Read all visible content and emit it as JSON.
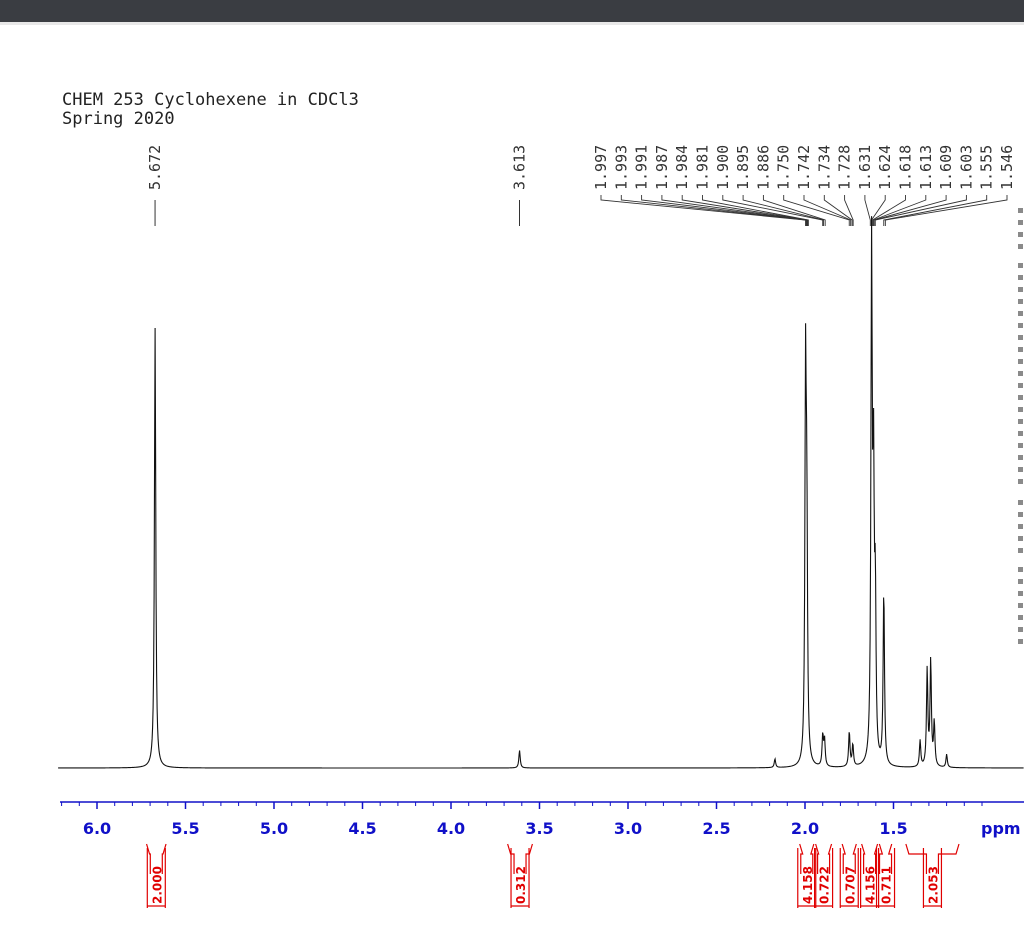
{
  "window": {
    "title_lines": [
      "CHEM 253 Cyclohexene in CDCl3",
      "Spring 2020"
    ]
  },
  "colors": {
    "spectrum_line": "#111111",
    "axis": "#1010c8",
    "integral": "#e00000",
    "top_bar": "#3a3d42"
  },
  "chart_data": {
    "type": "line",
    "title": "CHEM 253 Cyclohexene in CDCl3",
    "subtitle": "Spring 2020",
    "xlabel": "ppm",
    "ylabel": "",
    "x_reversed": true,
    "xlim": [
      6.22,
      0.72
    ],
    "x_ticks": [
      "6.0",
      "5.5",
      "5.0",
      "4.5",
      "4.0",
      "3.5",
      "3.0",
      "2.5",
      "2.0",
      "1.5"
    ],
    "peak_labels": [
      "5.672",
      "3.613",
      "1.997",
      "1.993",
      "1.991",
      "1.987",
      "1.984",
      "1.981",
      "1.900",
      "1.895",
      "1.886",
      "1.750",
      "1.742",
      "1.734",
      "1.728",
      "1.631",
      "1.624",
      "1.618",
      "1.613",
      "1.609",
      "1.603",
      "1.555",
      "1.546"
    ],
    "peaks": [
      {
        "ppm": 5.672,
        "height": 1.0
      },
      {
        "ppm": 3.613,
        "height": 0.04
      },
      {
        "ppm": 1.997,
        "height": 0.86
      },
      {
        "ppm": 1.99,
        "height": 0.5
      },
      {
        "ppm": 1.9,
        "height": 0.07
      },
      {
        "ppm": 1.89,
        "height": 0.06
      },
      {
        "ppm": 1.75,
        "height": 0.08
      },
      {
        "ppm": 1.73,
        "height": 0.05
      },
      {
        "ppm": 1.624,
        "height": 1.15
      },
      {
        "ppm": 1.613,
        "height": 0.6
      },
      {
        "ppm": 1.603,
        "height": 0.35
      },
      {
        "ppm": 1.555,
        "height": 0.4
      },
      {
        "ppm": 1.35,
        "height": 0.06
      },
      {
        "ppm": 1.31,
        "height": 0.22
      },
      {
        "ppm": 1.29,
        "height": 0.24
      },
      {
        "ppm": 1.27,
        "height": 0.1
      },
      {
        "ppm": 1.2,
        "height": 0.03
      },
      {
        "ppm": 2.17,
        "height": 0.02
      }
    ],
    "integrals": [
      {
        "value": "2.000",
        "from": 5.72,
        "to": 5.61
      },
      {
        "value": "0.312",
        "from": 3.68,
        "to": 3.54
      },
      {
        "value": "4.158",
        "from": 2.03,
        "to": 1.95
      },
      {
        "value": "0.722",
        "from": 1.94,
        "to": 1.85
      },
      {
        "value": "0.707",
        "from": 1.79,
        "to": 1.71
      },
      {
        "value": "4.156",
        "from": 1.68,
        "to": 1.59
      },
      {
        "value": "0.711",
        "from": 1.58,
        "to": 1.51
      },
      {
        "value": "2.053",
        "from": 1.43,
        "to": 1.13
      }
    ],
    "grid": false,
    "legend": "none"
  }
}
